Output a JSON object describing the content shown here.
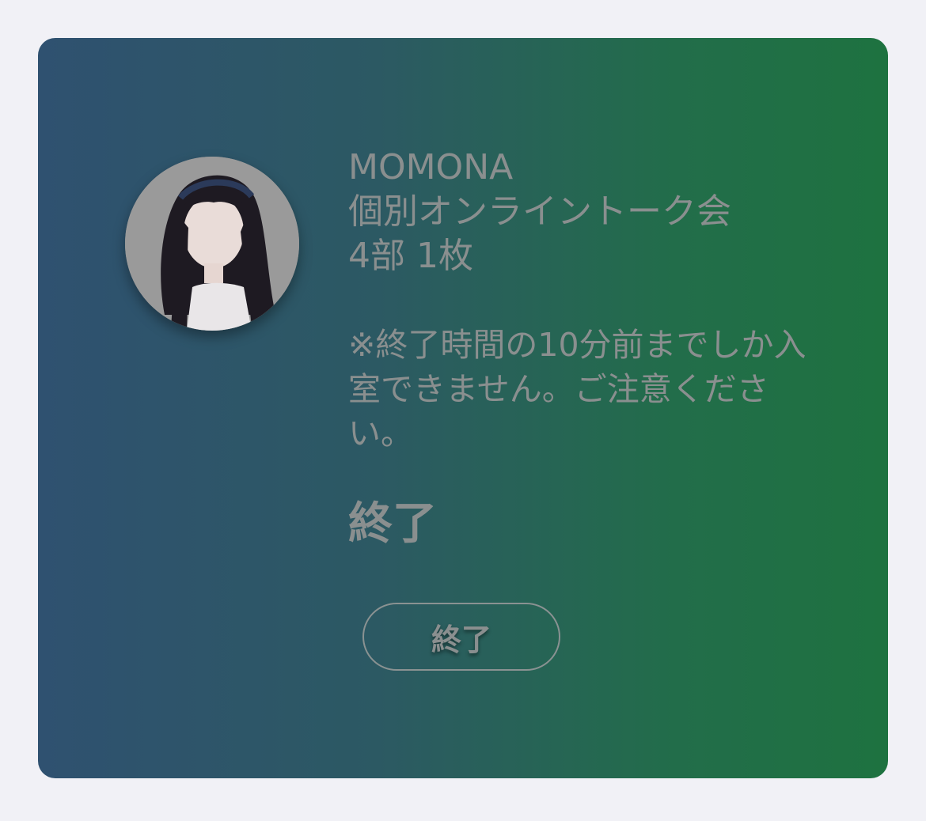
{
  "event": {
    "artist": "MOMONA",
    "title": "個別オンライントーク会",
    "session": "4部 1枚",
    "notice": "※終了時間の10分前までしか入室できません。ご注意ください。",
    "status": "終了"
  },
  "actions": {
    "button_label": "終了"
  },
  "colors": {
    "page_background": "#f1f1f6",
    "card_gradient_start": "#2f5170",
    "card_gradient_end": "#1e7240",
    "text": "#8a8f8f"
  },
  "icons": {
    "avatar": "artist-avatar-photo"
  }
}
